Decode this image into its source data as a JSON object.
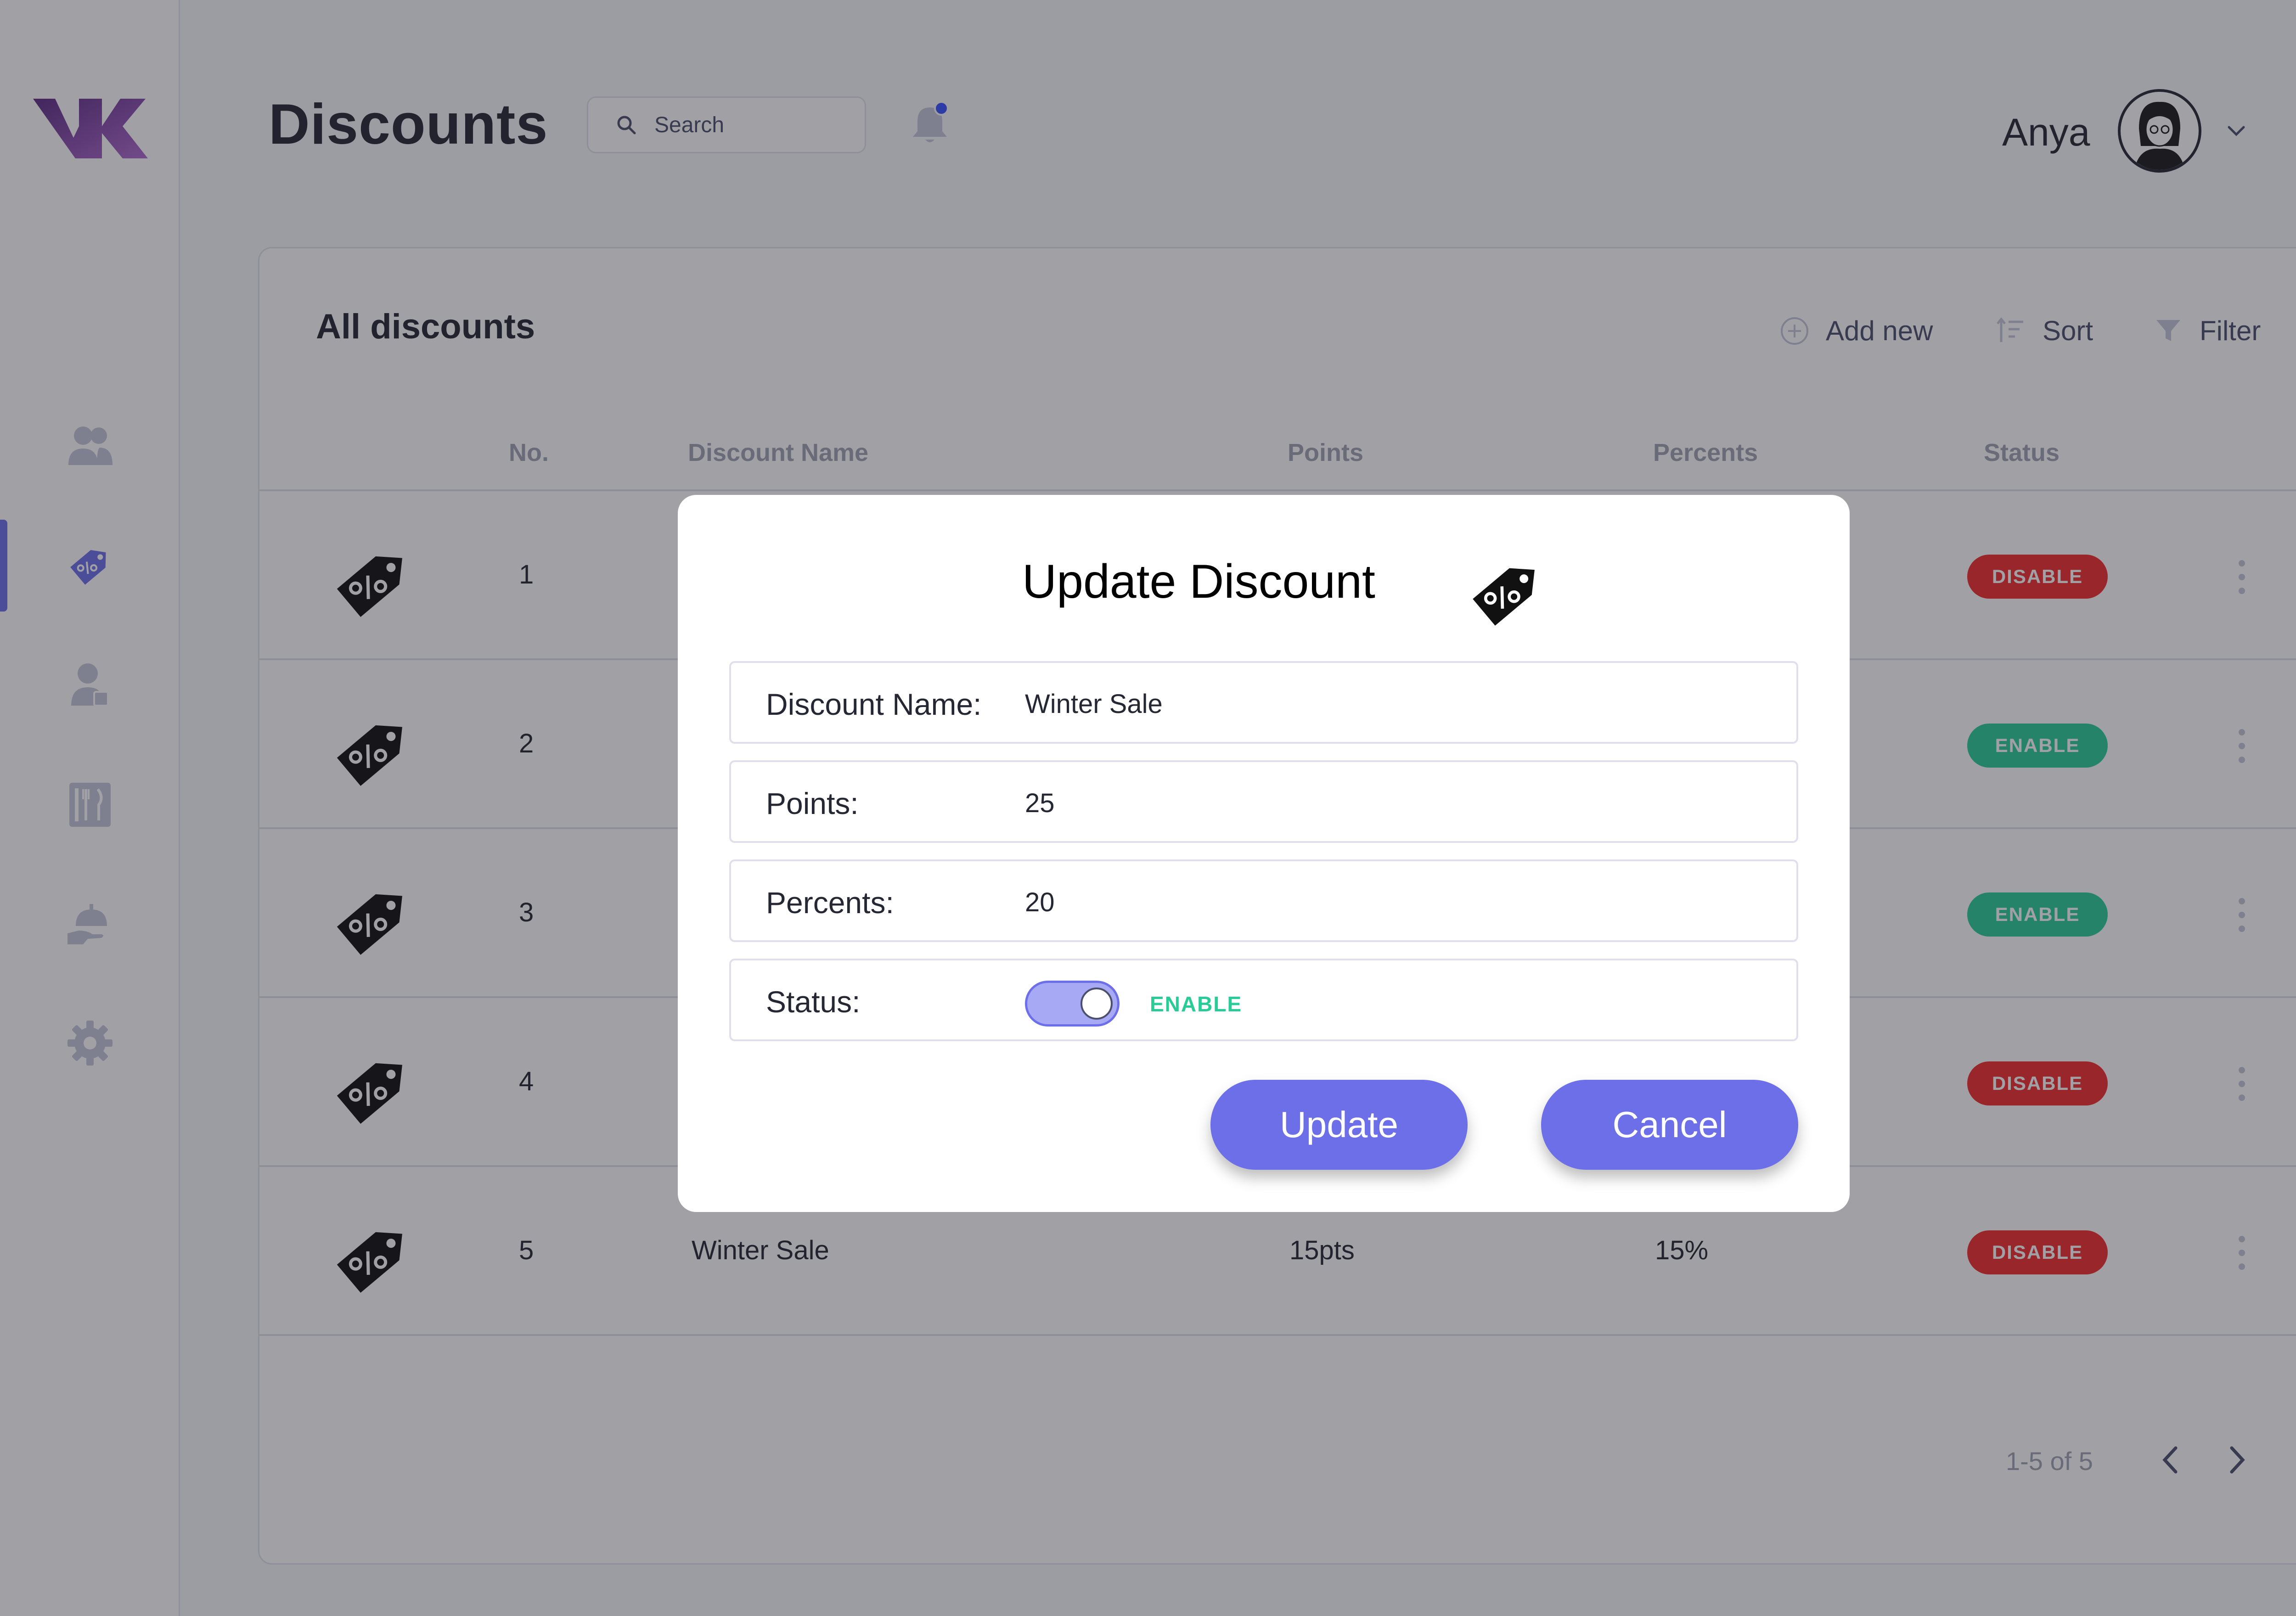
{
  "header": {
    "title": "Discounts",
    "search_placeholder": "Search",
    "user_name": "Anya"
  },
  "sidebar": {
    "items": [
      {
        "icon": "users-icon"
      },
      {
        "icon": "discount-tag-icon",
        "active": true
      },
      {
        "icon": "user-badge-icon"
      },
      {
        "icon": "menu-fork-knife-icon"
      },
      {
        "icon": "room-service-icon"
      },
      {
        "icon": "gear-icon"
      }
    ]
  },
  "panel": {
    "title": "All discounts",
    "tools": {
      "add_new": "Add new",
      "sort": "Sort",
      "filter": "Filter"
    },
    "columns": [
      "No.",
      "Discount Name",
      "Points",
      "Percents",
      "Status"
    ],
    "rows": [
      {
        "no": "1",
        "name": "",
        "points": "",
        "percent": "",
        "status": "DISABLE"
      },
      {
        "no": "2",
        "name": "",
        "points": "",
        "percent": "",
        "status": "ENABLE"
      },
      {
        "no": "3",
        "name": "",
        "points": "",
        "percent": "",
        "status": "ENABLE"
      },
      {
        "no": "4",
        "name": "",
        "points": "",
        "percent": "",
        "status": "DISABLE"
      },
      {
        "no": "5",
        "name": "Winter Sale",
        "points": "15pts",
        "percent": "15%",
        "status": "DISABLE"
      }
    ],
    "pagination": "1-5 of 5"
  },
  "modal": {
    "title": "Update Discount",
    "fields": {
      "name_label": "Discount Name:",
      "name_value": "Winter Sale",
      "points_label": "Points:",
      "points_value": "25",
      "percents_label": "Percents:",
      "percents_value": "20",
      "status_label": "Status:",
      "status_value": "ENABLE",
      "status_on": true
    },
    "update_label": "Update",
    "cancel_label": "Cancel"
  },
  "colors": {
    "accent": "#6d6fe8",
    "enable": "#29cc97",
    "disable": "#f12b2c",
    "brand": "#8e44ad"
  }
}
